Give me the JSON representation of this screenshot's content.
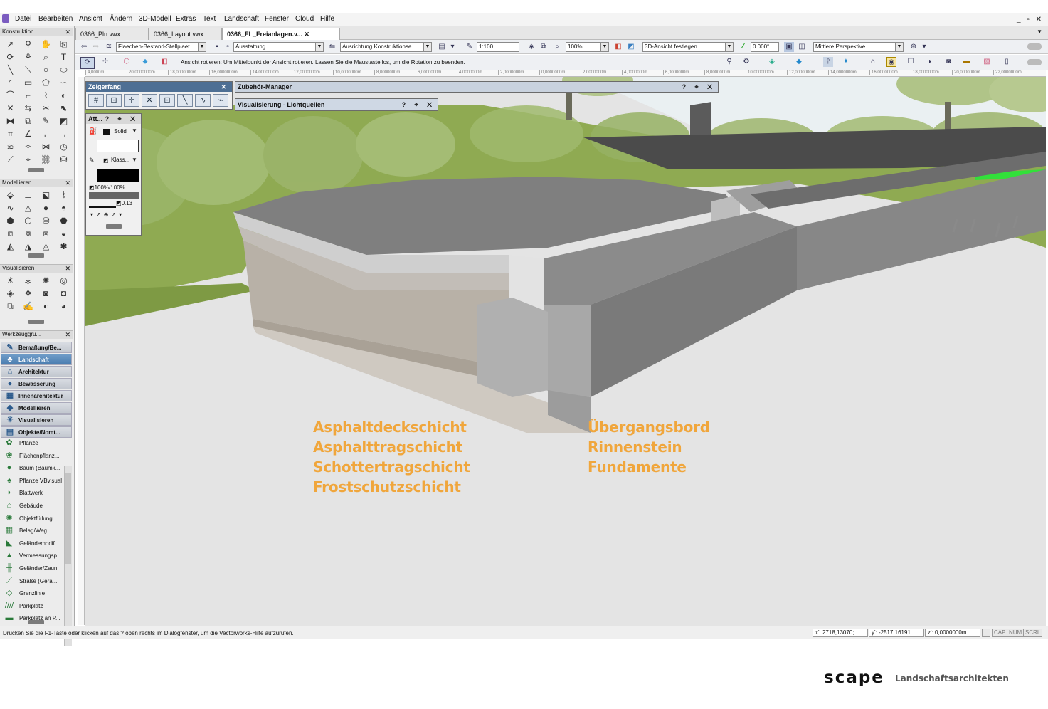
{
  "menu": [
    "Datei",
    "Bearbeiten",
    "Ansicht",
    "Ändern",
    "3D-Modell",
    "Extras",
    "Text",
    "Landschaft",
    "Fenster",
    "Cloud",
    "Hilfe"
  ],
  "window_controls": "_ ▫ ✕",
  "tabs": [
    "0366_Pln.vwx",
    "0366_Layout.vwx",
    "0366_FL_Freianlagen.v..."
  ],
  "viewbar": {
    "layer": "Flaechen-Bestand-Stellplaet...",
    "class": "Ausstattung",
    "plane": "Ausrichtung Konstruktionse...",
    "scale": "1:100",
    "zoom": "100%",
    "view": "3D-Ansicht festlegen",
    "angle": "0.000°",
    "projection": "Mittlere Perspektive"
  },
  "hint": "Ansicht rotieren: Um Mittelpunkt der Ansicht rotieren. Lassen Sie die Maustaste los, um die Rotation zu beenden.",
  "ruler_ticks": [
    "4,0000m",
    "20,0000000m",
    "18,0000000m",
    "16,0000000m",
    "14,0000000m",
    "12,0000000m",
    "10,0000000m",
    "8,0000000m",
    "6,0000000m",
    "4,0000000m",
    "2,0000000m",
    "0,0000000m",
    "2,0000000m",
    "4,0000000m",
    "6,0000000m",
    "8,0000000m",
    "10,0000000m",
    "12,0000000m",
    "14,0000000m",
    "16,0000000m",
    "18,0000000m",
    "20,0000000m",
    "22,0000000m"
  ],
  "palettes": {
    "konstruktion": "Konstruktion",
    "modellieren": "Modellieren",
    "visualisieren": "Visualisieren",
    "werkzeuggruppen": "Werkzeuggru..."
  },
  "toolsets": [
    {
      "label": "Bemaßung/Be...",
      "icon": "✎"
    },
    {
      "label": "Landschaft",
      "icon": "♣",
      "active": true
    },
    {
      "label": "Architektur",
      "icon": "⌂"
    },
    {
      "label": "Bewässerung",
      "icon": "●"
    },
    {
      "label": "Innenarchitektur",
      "icon": "▦"
    },
    {
      "label": "Modellieren",
      "icon": "◆"
    },
    {
      "label": "Visualisieren",
      "icon": "☀"
    },
    {
      "label": "Objekte/Nomt...",
      "icon": "▤"
    }
  ],
  "objects": [
    {
      "label": "Pflanze",
      "icon": "✿"
    },
    {
      "label": "Flächenpflanz...",
      "icon": "❀"
    },
    {
      "label": "Baum (Baumk...",
      "icon": "●"
    },
    {
      "label": "Pflanze VBvisual",
      "icon": "♠"
    },
    {
      "label": "Blattwerk",
      "icon": "◗"
    },
    {
      "label": "Gebäude",
      "icon": "⌂"
    },
    {
      "label": "Objektfüllung",
      "icon": "✺"
    },
    {
      "label": "Belag/Weg",
      "icon": "▦"
    },
    {
      "label": "Geländemodifi...",
      "icon": "◣"
    },
    {
      "label": "Vermessungsp...",
      "icon": "▲"
    },
    {
      "label": "Geländer/Zaun",
      "icon": "╫"
    },
    {
      "label": "Straße (Gera...",
      "icon": "⟋"
    },
    {
      "label": "Grenzlinie",
      "icon": "◇"
    },
    {
      "label": "Parkplatz",
      "icon": "////"
    },
    {
      "label": "Parkplatz an P...",
      "icon": "▬"
    }
  ],
  "snap_palette": {
    "title": "Zeigerfang",
    "buttons": [
      "#",
      "⊡",
      "✛",
      "✕",
      "⊡",
      "╲",
      "∿",
      "⌁"
    ]
  },
  "attr_palette": {
    "title": "Att...",
    "fill_label": "Solid",
    "pen_label": "Klass...",
    "opacity": "100%/100%",
    "line_weight": "0.13"
  },
  "accessory_manager": {
    "title": "Zubehör-Manager"
  },
  "light_palette": {
    "title": "Visualisierung - Lichtquellen"
  },
  "layers_left": [
    "Asphaltdeckschicht",
    "Asphalttragschicht",
    "Schottertragschicht",
    "Frostschutzschicht"
  ],
  "layers_right": [
    "Übergangsbord",
    "Rinnenstein",
    "Fundamente"
  ],
  "status": {
    "message": "Drücken Sie die F1-Taste oder klicken auf das ? oben rechts im Dialogfenster, um die Vectorworks-Hilfe aufzurufen.",
    "x": "x': 2718,13070;",
    "y": "y': -2517,16191",
    "z": "z': 0,0000000m",
    "caps": "CAP",
    "num": "NUM",
    "scrl": "SCRL"
  },
  "brand": {
    "name": "scape",
    "subtitle": "Landschaftsarchitekten"
  },
  "colors": {
    "accent_orange": "#f0a63c",
    "title_blue": "#4e6f94",
    "grass": "#8faa52",
    "asphalt": "#7e7e7e"
  }
}
